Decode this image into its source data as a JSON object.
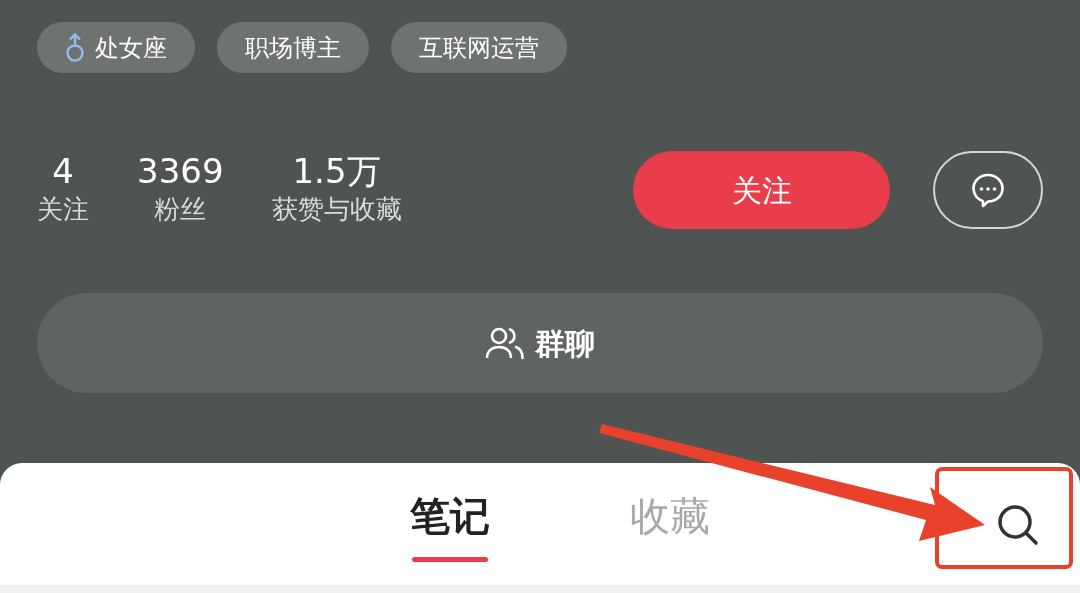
{
  "tags": [
    {
      "kind": "gender",
      "label": "处女座"
    },
    {
      "kind": "plain",
      "label": "职场博主"
    },
    {
      "kind": "plain",
      "label": "互联网运营"
    }
  ],
  "stats": [
    {
      "value": "4",
      "label": "关注"
    },
    {
      "value": "3369",
      "label": "粉丝"
    },
    {
      "value": "1.5万",
      "label": "获赞与收藏"
    }
  ],
  "follow_button": "关注",
  "group_chat_button": "群聊",
  "tabs": [
    {
      "label": "笔记",
      "selected": true
    },
    {
      "label": "收藏",
      "selected": false
    }
  ]
}
